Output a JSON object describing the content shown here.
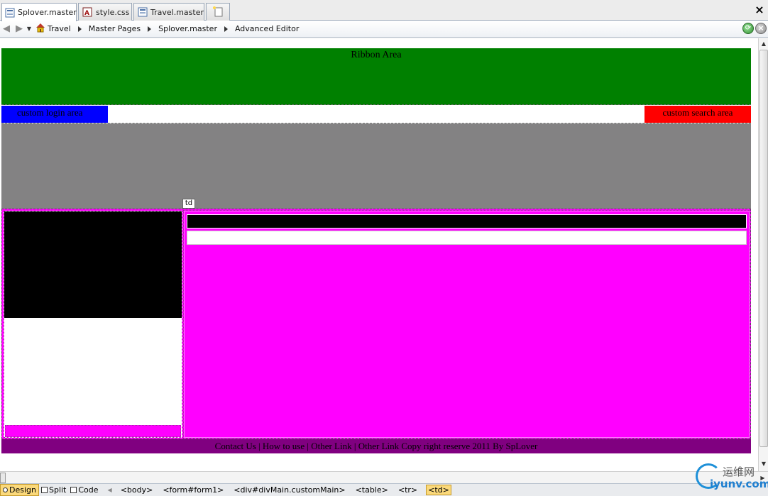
{
  "tabs": [
    {
      "label": "Splover.master",
      "icon": "master-page-icon",
      "active": true
    },
    {
      "label": "style.css",
      "icon": "css-file-icon",
      "active": false
    },
    {
      "label": "Travel.master",
      "icon": "master-page-icon",
      "active": false
    }
  ],
  "new_tab_icon": "new-page-icon",
  "close_label": "×",
  "breadcrumb": {
    "items": [
      "Travel",
      "Master Pages",
      "Splover.master",
      "Advanced Editor"
    ],
    "home_icon": "home-icon"
  },
  "canvas": {
    "ribbon_text": "Ribbon Area",
    "login_text": "custom login area",
    "search_text": "custom search area",
    "td_tag": "td",
    "footer_text": "Contact Us | How to use | Other Link | Other Link Copy right reserve 2011 By SpLover"
  },
  "colors": {
    "ribbon": "#008000",
    "login": "#0000ff",
    "search": "#ff0000",
    "banner": "#838283",
    "table": "#ff00ff",
    "footer": "#800080"
  },
  "views": [
    {
      "label": "Design",
      "active": true
    },
    {
      "label": "Split",
      "active": false
    },
    {
      "label": "Code",
      "active": false
    }
  ],
  "tag_path": [
    "<body>",
    "<form#form1>",
    "<div#divMain.customMain>",
    "<table>",
    "<tr>",
    "<td>"
  ],
  "watermark": {
    "cn": "运维网",
    "en": "iyunv.com"
  }
}
